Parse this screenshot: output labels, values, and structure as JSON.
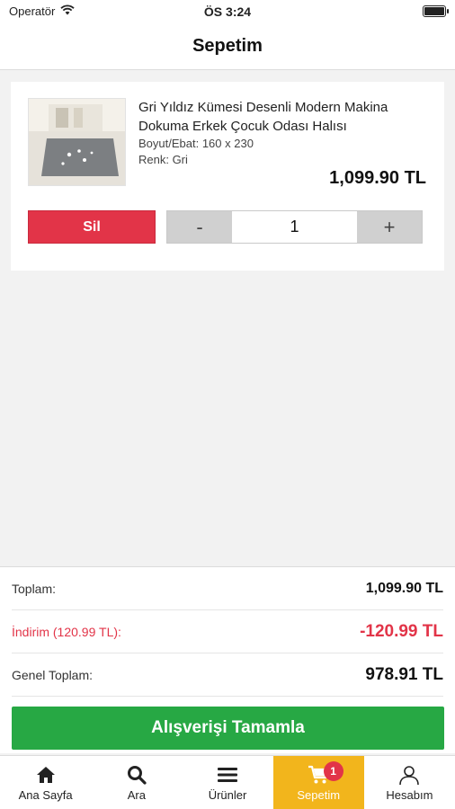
{
  "status_bar": {
    "carrier": "Operatör",
    "time": "ÖS 3:24"
  },
  "header": {
    "title": "Sepetim"
  },
  "cart": {
    "items": [
      {
        "name": "Gri Yıldız Kümesi Desenli Modern Makina Dokuma Erkek Çocuk Odası Halısı",
        "size": "Boyut/Ebat: 160 x 230",
        "color": "Renk: Gri",
        "price": "1,099.90 TL",
        "delete_label": "Sil",
        "decrement_label": "-",
        "quantity": "1",
        "increment_label": "+"
      }
    ]
  },
  "summary": {
    "subtotal_label": "Toplam:",
    "subtotal_value": "1,099.90 TL",
    "discount_label": "İndirim (120.99 TL):",
    "discount_value": "-120.99 TL",
    "grand_total_label": "Genel Toplam:",
    "grand_total_value": "978.91 TL",
    "checkout_label": "Alışverişi Tamamla"
  },
  "tabs": [
    {
      "label": "Ana Sayfa",
      "icon": "home-icon"
    },
    {
      "label": "Ara",
      "icon": "search-icon"
    },
    {
      "label": "Ürünler",
      "icon": "menu-icon"
    },
    {
      "label": "Sepetim",
      "icon": "cart-icon",
      "badge": "1",
      "active": true
    },
    {
      "label": "Hesabım",
      "icon": "user-icon"
    }
  ],
  "colors": {
    "accent_yellow": "#f2b51c",
    "danger_red": "#e23448",
    "checkout_green": "#27a844"
  }
}
